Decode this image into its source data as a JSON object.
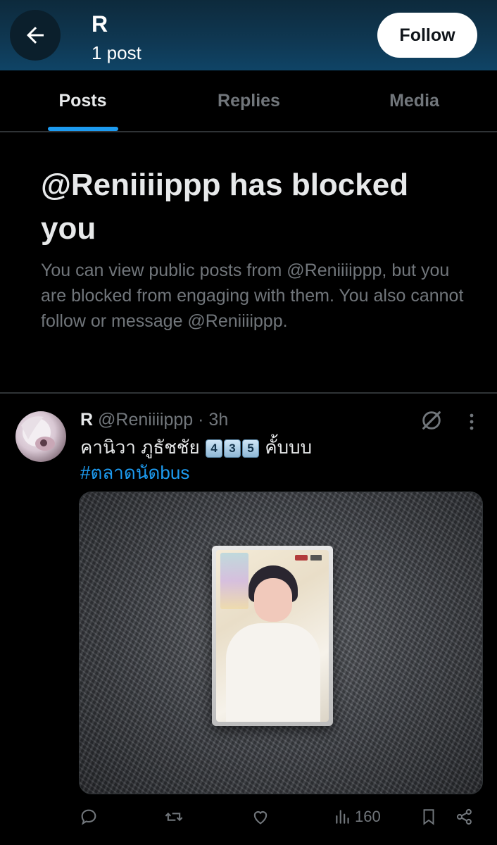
{
  "header": {
    "name": "R",
    "post_count": "1 post",
    "follow_label": "Follow"
  },
  "tabs": [
    {
      "label": "Posts",
      "active": true
    },
    {
      "label": "Replies",
      "active": false
    },
    {
      "label": "Media",
      "active": false
    }
  ],
  "blocked": {
    "title": "@Reniiiippp has blocked you",
    "description": "You can view public posts from @Reniiiippp, but you are blocked from engaging with them. You also cannot follow or message @Reniiiippp."
  },
  "post": {
    "name": "R",
    "handle": "@Reniiiippp",
    "separator": "·",
    "time": "3h",
    "text_prefix": "คานิวา ภูธัชชัย",
    "keycaps": [
      "4",
      "3",
      "5"
    ],
    "text_suffix": "คั้บบบ",
    "hashtag": "#ตลาดนัดbus",
    "views": "160"
  },
  "colors": {
    "accent": "#1d9bf0",
    "muted": "#71767b",
    "header": "#0f3853"
  },
  "icons": {
    "back": "arrow-left-icon",
    "grok": "grok-icon",
    "more": "more-vertical-icon",
    "reply": "reply-icon",
    "repost": "repost-icon",
    "like": "like-icon",
    "views": "views-icon",
    "bookmark": "bookmark-icon",
    "share": "share-icon"
  }
}
